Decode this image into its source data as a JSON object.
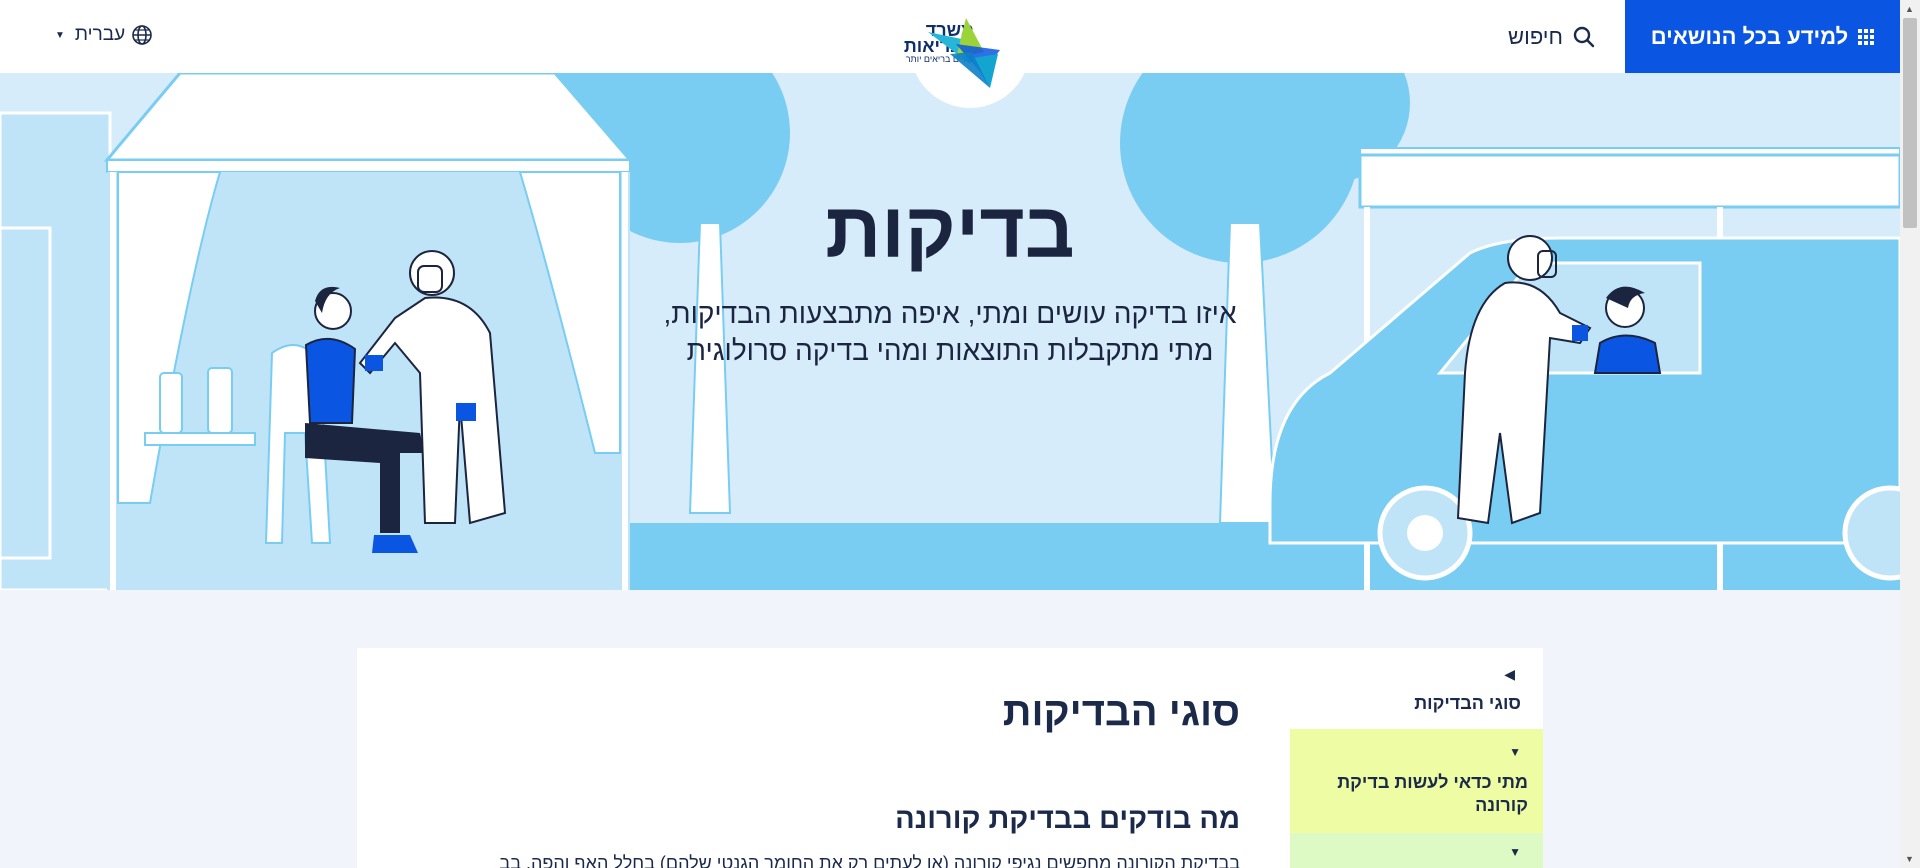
{
  "header": {
    "topics_button": "למידע בכל הנושאים",
    "search_label": "חיפוש",
    "language": "עברית",
    "logo": {
      "line1": "משרד",
      "line2": "הבריאות",
      "tagline": "לחיים בריאים יותר"
    }
  },
  "hero": {
    "title": "בדיקות",
    "subtitle_line1": "איזו בדיקה עושים ומתי, איפה מתבצעות הבדיקות,",
    "subtitle_line2": "מתי מתקבלות התוצאות ומהי בדיקה סרולוגית"
  },
  "sidebar": {
    "title": "סוגי הבדיקות",
    "items": [
      {
        "label": "מתי כדאי לעשות בדיקת קורונה"
      },
      {
        "label": ""
      }
    ]
  },
  "main": {
    "title": "סוגי הבדיקות",
    "section_heading": "מה בודקים בבדיקת קורונה",
    "section_text": "בבדיקת הקורונה מחפשים נגיפי קורונה (או לעתים רק את החומר הגנטי שלהם) בחלל האף והפה. בב"
  },
  "colors": {
    "brand_blue": "#0a56e3",
    "sidebar_active": "#eefca4",
    "sidebar_next": "#ddfac5",
    "hero_bg": "#d7ecfa"
  }
}
